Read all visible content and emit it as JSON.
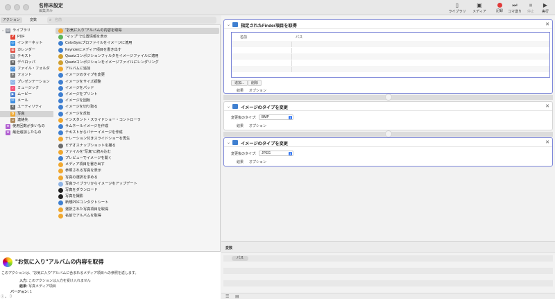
{
  "window": {
    "title": "名称未設定",
    "subtitle": "編集済み"
  },
  "toolbar": {
    "items": [
      {
        "label": "ライブラリ",
        "icon": "sidebar-icon",
        "glyph": "▯",
        "enabled": true
      },
      {
        "label": "メディア",
        "icon": "photo-icon",
        "glyph": "▣",
        "enabled": true
      },
      {
        "label": "記録",
        "icon": "record-icon",
        "glyph": "",
        "enabled": true
      },
      {
        "label": "コマ送り",
        "icon": "step-icon",
        "glyph": "⏭",
        "enabled": true
      },
      {
        "label": "停止",
        "icon": "stop-icon",
        "glyph": "■",
        "enabled": false
      },
      {
        "label": "実行",
        "icon": "play-icon",
        "glyph": "▶",
        "enabled": true
      }
    ],
    "record_color": "#e03a3a"
  },
  "library": {
    "tabs": [
      "アクション",
      "変数"
    ],
    "search_placeholder": "名前",
    "search_icon": "search-icon",
    "categories": [
      {
        "label": "ライブラリ",
        "color": "#8a8f99",
        "glyph": "▤",
        "level": 0
      },
      {
        "label": "PDF",
        "color": "#e34234",
        "glyph": "P",
        "level": 1
      },
      {
        "label": "インターネット",
        "color": "#2f8ce0",
        "glyph": "◎",
        "level": 1
      },
      {
        "label": "カレンダー",
        "color": "#e04b3f",
        "glyph": "▦",
        "level": 1
      },
      {
        "label": "テキスト",
        "color": "#9aa0a8",
        "glyph": "✎",
        "level": 1
      },
      {
        "label": "デベロッパ",
        "color": "#6a6a6a",
        "glyph": "✕",
        "level": 1
      },
      {
        "label": "ファイル・フォルダ",
        "color": "#4a90d9",
        "glyph": "▭",
        "level": 1
      },
      {
        "label": "フォント",
        "color": "#7c7c7c",
        "glyph": "F",
        "level": 1
      },
      {
        "label": "プレゼンテーション",
        "color": "#8fb5e6",
        "glyph": "▭",
        "level": 1
      },
      {
        "label": "ミュージック",
        "color": "#f2557a",
        "glyph": "♪",
        "level": 1
      },
      {
        "label": "ムービー",
        "color": "#4b7fd1",
        "glyph": "▶",
        "level": 1
      },
      {
        "label": "メール",
        "color": "#3d8de0",
        "glyph": "✉",
        "level": 1
      },
      {
        "label": "ユーティリティ",
        "color": "#6b6b6b",
        "glyph": "✕",
        "level": 1
      },
      {
        "label": "写真",
        "color": "#f0a830",
        "glyph": "✿",
        "level": 1
      },
      {
        "label": "連絡先",
        "color": "#b08a5a",
        "glyph": "☺",
        "level": 1
      },
      {
        "label": "使用回数が多いもの",
        "color": "#b15fd1",
        "glyph": "★",
        "level": 0
      },
      {
        "label": "最近追加したもの",
        "color": "#b15fd1",
        "glyph": "★",
        "level": 0
      }
    ],
    "selected_category": 13,
    "actions": [
      {
        "label": "\"お気に入り\"アルバムの内容を取得",
        "color": "#f0a830"
      },
      {
        "label": "\"マップ\"で位置情報を表示",
        "color": "#5bb55b"
      },
      {
        "label": "ColorSyncプロファイルをイメージに適用",
        "color": "#3f7fd0"
      },
      {
        "label": "Keynoteにメディア項目を書き出す",
        "color": "#3f7fd0"
      },
      {
        "label": "Quartzコンポジションフィルタをイメージファイルに適用",
        "color": "#d0a030"
      },
      {
        "label": "Quartzコンポジションをイメージファイルにレンダリング",
        "color": "#d0a030"
      },
      {
        "label": "アルバムに追加",
        "color": "#f0a830"
      },
      {
        "label": "イメージのタイプを変更",
        "color": "#3f7fd0"
      },
      {
        "label": "イメージをサイズ調整",
        "color": "#3f7fd0"
      },
      {
        "label": "イメージをパッド",
        "color": "#3f7fd0"
      },
      {
        "label": "イメージをプリント",
        "color": "#3f7fd0"
      },
      {
        "label": "イメージを回転",
        "color": "#3f7fd0"
      },
      {
        "label": "イメージを切り取る",
        "color": "#3f7fd0"
      },
      {
        "label": "イメージを反転",
        "color": "#3f7fd0"
      },
      {
        "label": "インスタント・スライドショー・コントローラ",
        "color": "#f0a830"
      },
      {
        "label": "サムネールイメージを作成",
        "color": "#3f7fd0"
      },
      {
        "label": "テキストからバナーイメージを作成",
        "color": "#3f7fd0"
      },
      {
        "label": "ナレーション付きスライドショーを再生",
        "color": "#f0a830"
      },
      {
        "label": "ビデオスナップショットを撮る",
        "color": "#6b6b6b"
      },
      {
        "label": "ファイルを\"写真\"に読み込む",
        "color": "#f0a830"
      },
      {
        "label": "プレビューでイメージを開く",
        "color": "#3f7fd0"
      },
      {
        "label": "メディア項目を書き出す",
        "color": "#f0a830"
      },
      {
        "label": "参照される写真を表示",
        "color": "#f0a830"
      },
      {
        "label": "写真の選択を求める",
        "color": "#f0a830"
      },
      {
        "label": "写真ライブラリからイメージをアップデート",
        "color": "#8fb5e6"
      },
      {
        "label": "写真をダウンロード",
        "color": "#222222"
      },
      {
        "label": "写真を撮影",
        "color": "#222222"
      },
      {
        "label": "新規PDFコンタクトシート",
        "color": "#3f7fd0"
      },
      {
        "label": "選択された写真項目を取得",
        "color": "#f0a830"
      },
      {
        "label": "名前でアルバムを取得",
        "color": "#f0a830"
      }
    ],
    "selected_action": 0
  },
  "description": {
    "title": "\"お気に入り\"アルバムの内容を取得",
    "text": "このアクションは、\"お気に入り\"アルバムに含まれるメディア項目への参照を返します。",
    "input_label": "入力:",
    "input_value": "このアクションは入力を受け入れません",
    "result_label": "結果:",
    "result_value": "写真メディア項目",
    "version_label": "バージョン:",
    "version_value": "1"
  },
  "workflow": {
    "blocks": [
      {
        "title": "指定されたFinder項目を取得",
        "columns": [
          "名前",
          "パス"
        ],
        "buttons": [
          "追加...",
          "削除"
        ],
        "tabs": [
          "結果",
          "オプション"
        ]
      },
      {
        "title": "イメージのタイプを変更",
        "field_label": "変更後のタイプ:",
        "field_value": "BMP",
        "tabs": [
          "結果",
          "オプション"
        ]
      },
      {
        "title": "イメージのタイプを変更",
        "field_label": "変更後のタイプ:",
        "field_value": "JPEG",
        "tabs": [
          "結果",
          "オプション"
        ]
      }
    ],
    "selected_color": "#7b85d8"
  },
  "variables": {
    "title": "変数",
    "items": [
      "パス"
    ]
  }
}
